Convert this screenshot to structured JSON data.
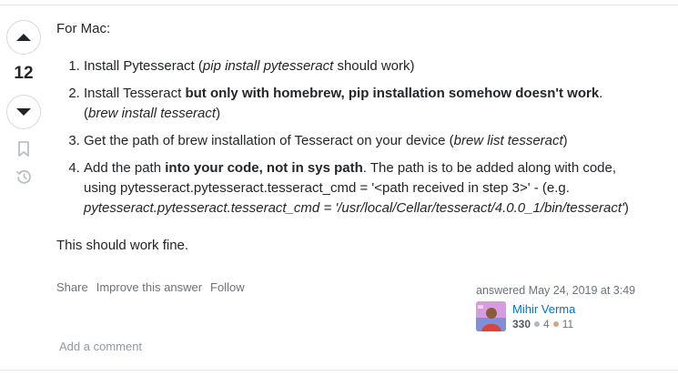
{
  "vote": {
    "count": "12"
  },
  "answer": {
    "intro": "For Mac:",
    "steps": [
      {
        "t1": "Install Pytesseract (",
        "t1_italic": "pip install pytesseract",
        "t1_end": " should work)"
      },
      {
        "t1": "Install Tesseract ",
        "bold": "but only with homebrew, pip installation somehow doesn't work",
        "t1_end": ".",
        "line2_open": "(",
        "line2_italic": "brew install tesseract",
        "line2_close": ")"
      },
      {
        "t1": "Get the path of brew installation of Tesseract on your device (",
        "t1_italic": "brew list tesseract",
        "t1_end": ")"
      },
      {
        "t1": "Add the path ",
        "bold": "into your code, not in sys path",
        "t1_end": ". The path is to be added along with code,",
        "line2": "using pytesseract.pytesseract.tesseract_cmd = '<path received in step 3>' - (e.g.",
        "line3_italic": "pytesseract.pytesseract.tesseract_cmd = '/usr/local/Cellar/tesseract/4.0.0_1/bin/tesseract'",
        "line3_close": ")"
      }
    ],
    "closing": "This should work fine."
  },
  "actions": {
    "share": "Share",
    "improve": "Improve this answer",
    "follow": "Follow"
  },
  "author": {
    "answered_label": "answered",
    "answered_date": "May 24, 2019 at 3:49",
    "name": "Mihir Verma",
    "reputation": "330",
    "silver_badges": "4",
    "bronze_badges": "11",
    "silver_color": "#b4b8bc",
    "bronze_color": "#d1a684"
  },
  "comment": {
    "add": "Add a comment"
  },
  "icons": {
    "up": "upvote-arrow-icon",
    "down": "downvote-arrow-icon",
    "bookmark": "bookmark-icon",
    "history": "history-icon"
  }
}
